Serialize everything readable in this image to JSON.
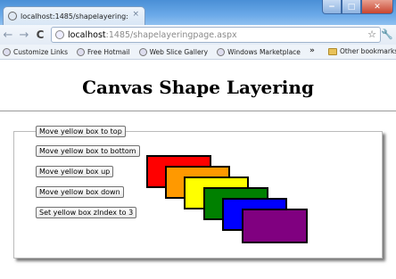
{
  "browser": {
    "tab_title": "localhost:1485/shapelayering:",
    "tab_close": "×",
    "url_host": "localhost",
    "url_path": ":1485/shapelayeringpage.aspx",
    "back_glyph": "←",
    "forward_glyph": "→",
    "reload_glyph": "C",
    "star_glyph": "☆",
    "wrench_glyph": "🔧",
    "window_buttons": {
      "minimize": "−",
      "maximize": "□",
      "close": "✕"
    },
    "bookmarks": [
      "Customize Links",
      "Free Hotmail",
      "Web Slice Gallery",
      "Windows Marketplace"
    ],
    "bookmark_overflow": "»",
    "other_bookmarks": "Other bookmarks"
  },
  "page": {
    "title": "Canvas Shape Layering",
    "buttons": [
      "Move yellow box to top",
      "Move yellow box to bottom",
      "Move yellow box up",
      "Move yellow box down",
      "Set yellow box zIndex to 3"
    ],
    "boxes": [
      {
        "name": "red",
        "color": "#ff0000"
      },
      {
        "name": "orange",
        "color": "#ff9900"
      },
      {
        "name": "yellow",
        "color": "#ffff00"
      },
      {
        "name": "green",
        "color": "#008000"
      },
      {
        "name": "blue",
        "color": "#0000ff"
      },
      {
        "name": "purple",
        "color": "#800080"
      }
    ]
  }
}
